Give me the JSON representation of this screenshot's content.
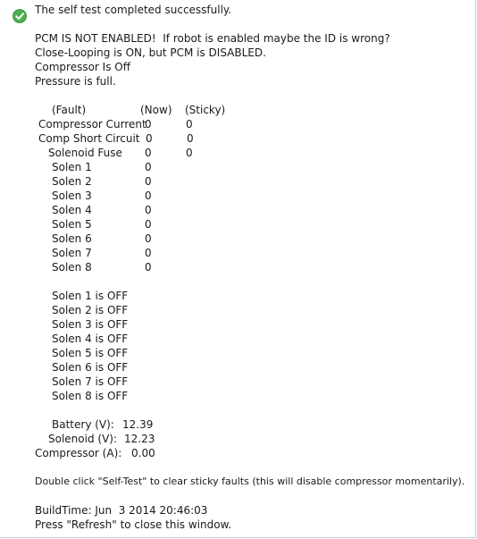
{
  "status": {
    "icon": "check-circle-icon",
    "icon_color": "#4caf50",
    "message": "The self test completed successfully."
  },
  "notices": [
    "PCM IS NOT ENABLED!  If robot is enabled maybe the ID is wrong?",
    "Close-Looping is ON, but PCM is DISABLED.",
    "Compressor Is Off",
    "Pressure is full."
  ],
  "fault_table": {
    "headers": {
      "fault": "(Fault)",
      "now": "(Now)",
      "sticky": "(Sticky)"
    },
    "rows": [
      {
        "name": "Compressor Current",
        "now": "0",
        "sticky": "0"
      },
      {
        "name": "Comp Short Circuit",
        "now": "0",
        "sticky": "0"
      },
      {
        "name": "Solenoid Fuse",
        "now": "0",
        "sticky": "0"
      },
      {
        "name": "Solen 1",
        "now": "0",
        "sticky": ""
      },
      {
        "name": "Solen 2",
        "now": "0",
        "sticky": ""
      },
      {
        "name": "Solen 3",
        "now": "0",
        "sticky": ""
      },
      {
        "name": "Solen 4",
        "now": "0",
        "sticky": ""
      },
      {
        "name": "Solen 5",
        "now": "0",
        "sticky": ""
      },
      {
        "name": "Solen 6",
        "now": "0",
        "sticky": ""
      },
      {
        "name": "Solen 7",
        "now": "0",
        "sticky": ""
      },
      {
        "name": "Solen 8",
        "now": "0",
        "sticky": ""
      }
    ]
  },
  "solenoid_states": [
    "Solen 1 is OFF",
    "Solen 2 is OFF",
    "Solen 3 is OFF",
    "Solen 4 is OFF",
    "Solen 5 is OFF",
    "Solen 6 is OFF",
    "Solen 7 is OFF",
    "Solen 8 is OFF"
  ],
  "readings": [
    {
      "label": "Battery (V):",
      "value": "12.39"
    },
    {
      "label": "Solenoid (V):",
      "value": "12.23"
    },
    {
      "label": "Compressor (A):",
      "value": "0.00"
    }
  ],
  "footer": {
    "hint": "Double click \"Self-Test\" to clear sticky faults (this will disable compressor momentarily).",
    "build_time": "BuildTime: Jun  3 2014 20:46:03",
    "close_hint": "Press \"Refresh\" to close this window."
  }
}
